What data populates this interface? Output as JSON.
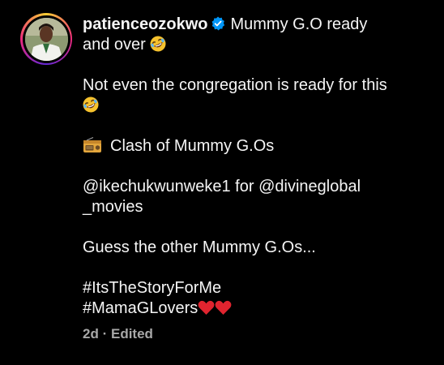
{
  "post": {
    "username": "patienceozokwo",
    "line1_text": "Mummy G.O ready",
    "line2_text": "and over",
    "para2_line1": "Not even the congregation is ready for this",
    "para3_text": "Clash of Mummy G.Os",
    "para4_line1": "@ikechukwunweke1 for @divineglobal",
    "para4_line2": "_movies",
    "para5_text": "Guess the other Mummy G.Os...",
    "hashtag1": "#ItsTheStoryForMe",
    "hashtag2": "#MamaGLovers",
    "time_ago": "2d",
    "separator": "·",
    "edited_label": "Edited"
  },
  "icons": {
    "verified": "verified-badge-icon",
    "laughing": "rolling-on-floor-laughing-emoji",
    "radio": "radio-emoji",
    "heart": "red-heart-emoji"
  },
  "colors": {
    "background": "#000000",
    "text": "#f5f5f5",
    "meta": "#a8a8a8",
    "verified": "#0095f6",
    "heart": "#e0242f"
  }
}
